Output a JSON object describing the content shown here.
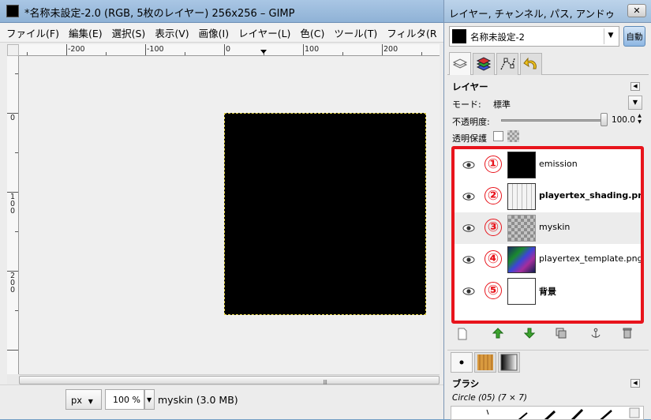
{
  "main_window": {
    "title": "*名称未設定-2.0 (RGB, 5枚のレイヤー) 256x256 – GIMP",
    "menu": [
      "ファイル(F)",
      "編集(E)",
      "選択(S)",
      "表示(V)",
      "画像(I)",
      "レイヤー(L)",
      "色(C)",
      "ツール(T)",
      "フィルタ(R"
    ],
    "ruler_top_labels": [
      "-200",
      "-100",
      "0",
      "100",
      "200"
    ],
    "ruler_left_labels": [
      "0",
      "100",
      "200"
    ],
    "status": {
      "unit": "px",
      "zoom": "100 %",
      "text": "myskin (3.0 MB)"
    }
  },
  "dock": {
    "title": "レイヤー, チャンネル, パス, アンドゥ",
    "image_name": "名称未設定-2",
    "auto_label": "自動",
    "layers_panel": {
      "header": "レイヤー",
      "mode_label": "モード:",
      "mode_value": "標準",
      "opacity_label": "不透明度:",
      "opacity_value": "100.0",
      "lock_label": "透明保護"
    },
    "layers": [
      {
        "num": "①",
        "name": "emission",
        "thumb": "black",
        "bold": false,
        "selected": false
      },
      {
        "num": "②",
        "name": "playertex_shading.png",
        "thumb": "shading",
        "bold": true,
        "selected": false
      },
      {
        "num": "③",
        "name": "myskin",
        "thumb": "checker",
        "bold": false,
        "selected": true
      },
      {
        "num": "④",
        "name": "playertex_template.png",
        "thumb": "template",
        "bold": false,
        "selected": false
      },
      {
        "num": "⑤",
        "name": "背景",
        "thumb": "white",
        "bold": true,
        "selected": false
      }
    ],
    "brush_panel": {
      "header": "ブラシ",
      "brush_name": "Circle (05) (7 × 7)"
    }
  },
  "colors": {
    "highlight_border": "#e8141c",
    "annotation_numbers": "#e8141c",
    "image_canvas": "#000000"
  }
}
